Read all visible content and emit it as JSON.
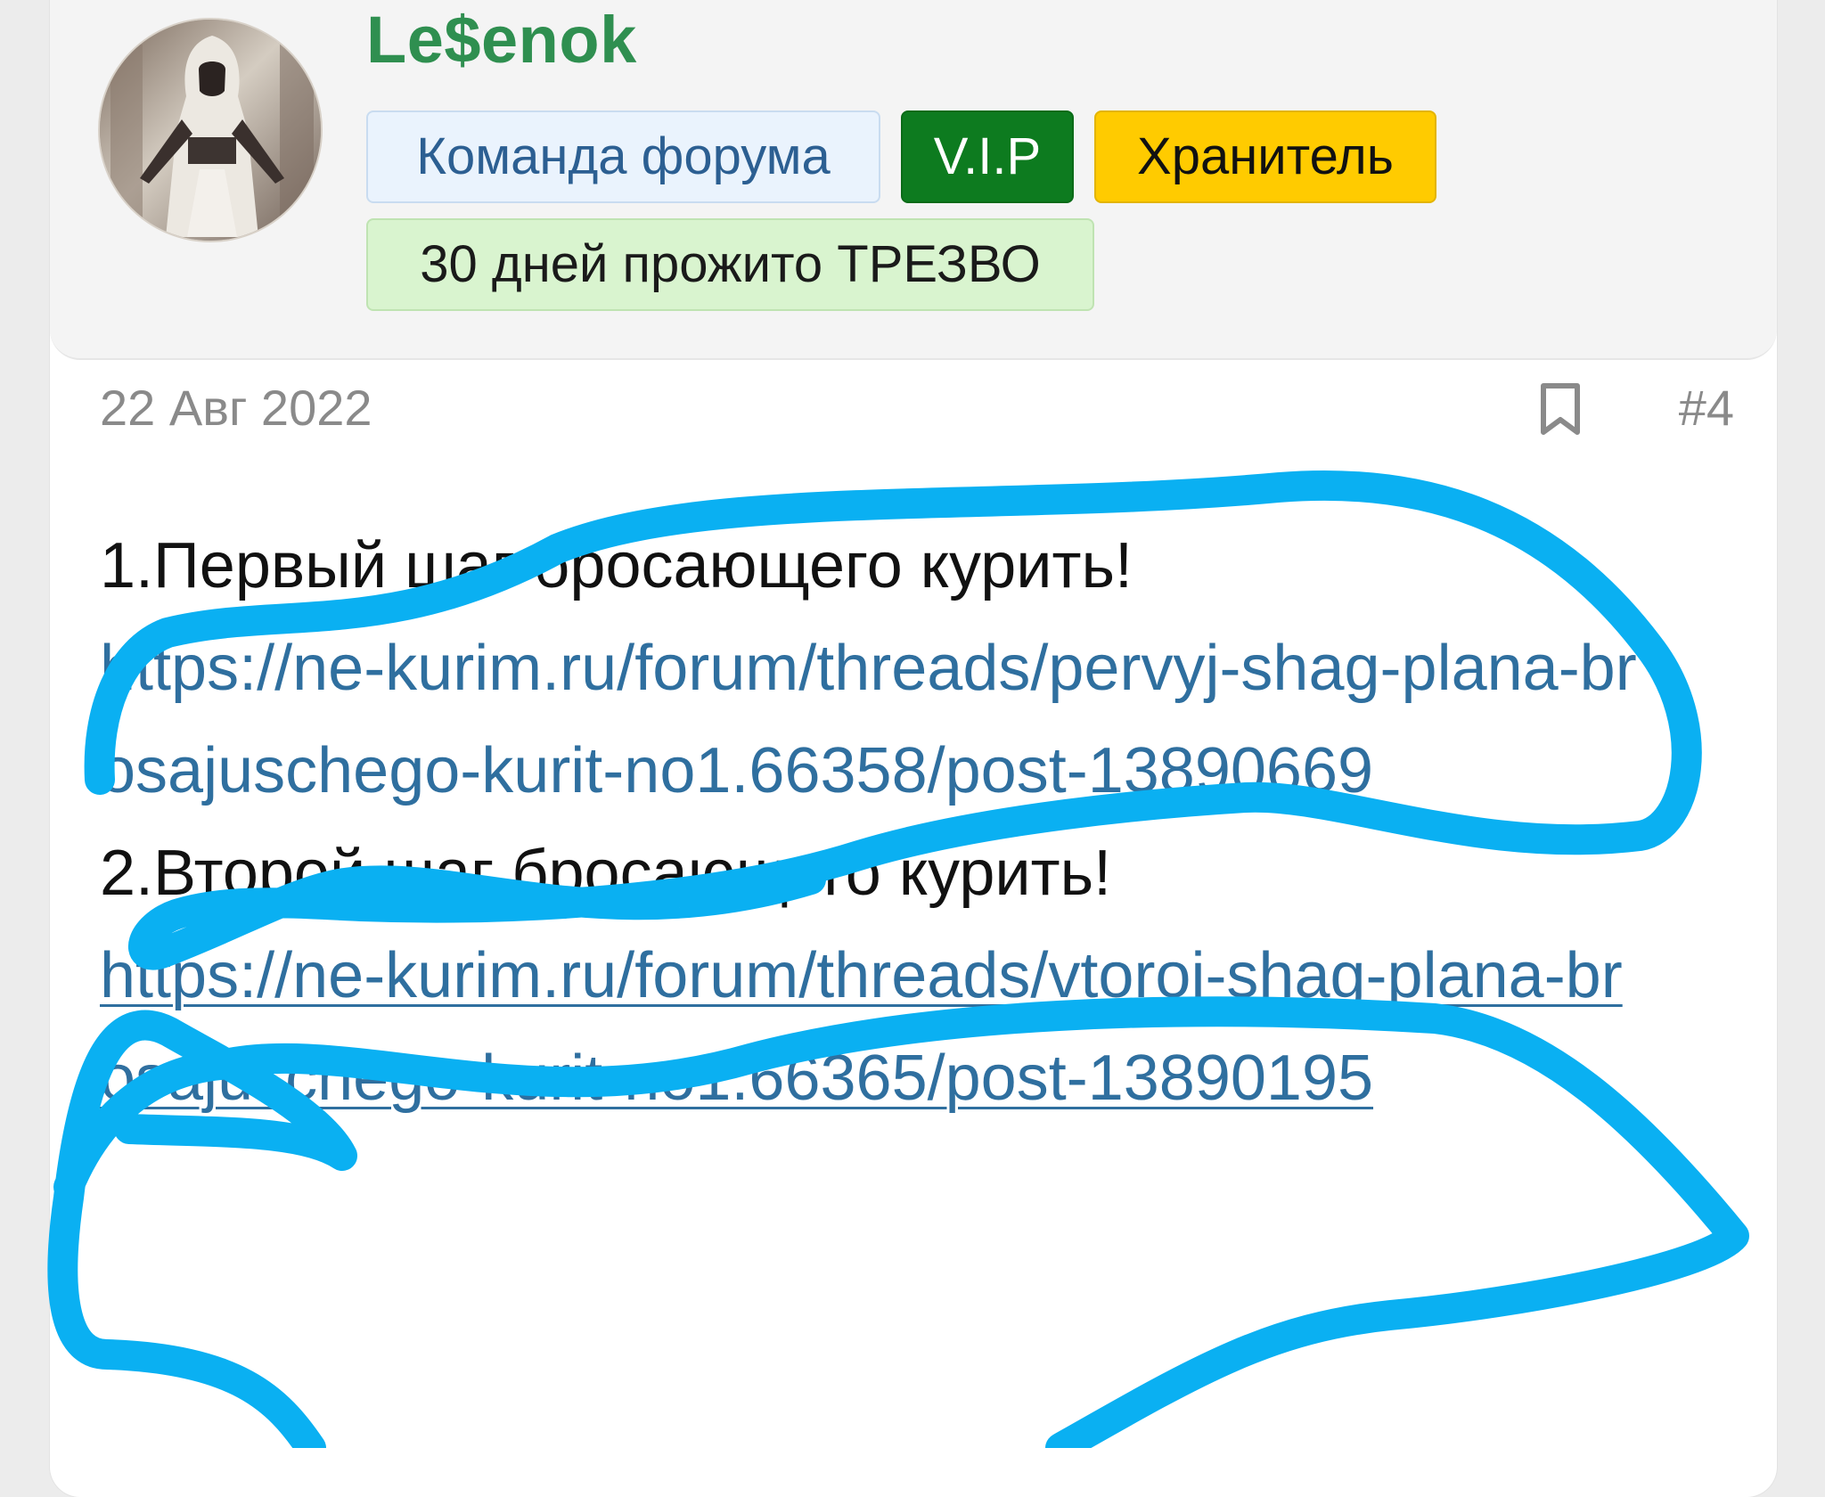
{
  "profile": {
    "username": "Le$enok",
    "badges": [
      {
        "label": "Команда форума",
        "color": "#eaf3fd"
      },
      {
        "label": "V.I.P",
        "color": "#0d7b1f"
      },
      {
        "label": "Хранитель",
        "color": "#ffcb00"
      },
      {
        "label": "30 дней прожито ТРЕЗВО",
        "color": "#d9f4cf"
      }
    ]
  },
  "post": {
    "date": "22 Авг 2022",
    "number": "#4",
    "bookmark_icon": "bookmark-icon",
    "items": [
      {
        "title": "1.Первый шаг бросающего курить!",
        "link": "https://ne-kurim.ru/forum/threads/pervyj-shag-plana-brosajuschego-kurit-no1.66358/post-13890669"
      },
      {
        "title": "2.Второй шаг бросающего курить!",
        "link": "https://ne-kurim.ru/forum/threads/vtoroj-shag-plana-brosajuschego-kurit-no1.66365/post-13890195"
      }
    ]
  },
  "annotation": {
    "color": "#0ab0f2"
  }
}
